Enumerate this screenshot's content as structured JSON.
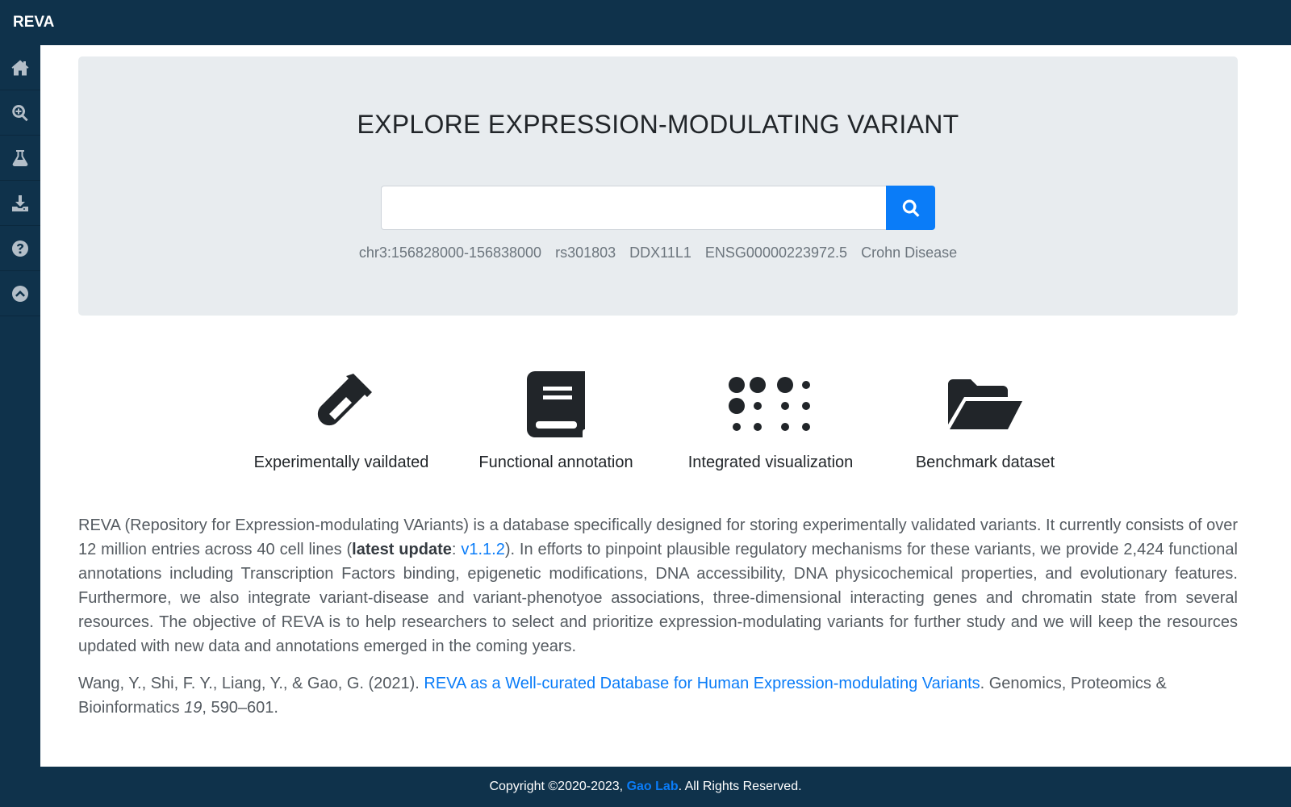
{
  "app": {
    "brand": "REVA"
  },
  "sidebar": {
    "items": [
      {
        "icon": "home-icon"
      },
      {
        "icon": "search-plus-icon"
      },
      {
        "icon": "flask-icon"
      },
      {
        "icon": "download-icon"
      },
      {
        "icon": "question-circle-icon"
      },
      {
        "icon": "chevron-up-circle-icon"
      }
    ]
  },
  "hero": {
    "title": "EXPLORE EXPRESSION-MODULATING VARIANT",
    "search_value": "",
    "examples": [
      "chr3:156828000-156838000",
      "rs301803",
      "DDX11L1",
      "ENSG00000223972.5",
      "Crohn Disease"
    ]
  },
  "features": [
    {
      "icon": "test-tube-icon",
      "label": "Experimentally vaildated"
    },
    {
      "icon": "book-icon",
      "label": "Functional annotation"
    },
    {
      "icon": "braille-icon",
      "label": "Integrated visualization"
    },
    {
      "icon": "folder-open-icon",
      "label": "Benchmark dataset"
    }
  ],
  "description": {
    "part1": "REVA (Repository for Expression-modulating VAriants) is a database specifically designed for storing experimentally validated variants. It currently consists of over 12 million entries across 40 cell lines (",
    "latest_update_label": "latest update",
    "colon": ": ",
    "version_link": "v1.1.2",
    "part2": "). In efforts to pinpoint plausible regulatory mechanisms for these variants, we provide 2,424 functional annotations including Transcription Factors binding, epigenetic modifications, DNA accessibility, DNA physicochemical properties, and evolutionary features. Furthermore, we also integrate variant-disease and variant-phenotyoe associations, three-dimensional interacting genes and chromatin state from several resources. The objective of REVA is to help researchers to select and prioritize expression-modulating variants for further study and we will keep the resources updated with new data and annotations emerged in the coming years."
  },
  "citation": {
    "authors": "Wang, Y., Shi, F. Y., Liang, Y., & Gao, G. (2021). ",
    "title_link": "REVA as a Well-curated Database for Human Expression-modulating Variants",
    "journal": ". Genomics, Proteomics & Bioinformatics ",
    "volume": "19",
    "pages": ", 590–601."
  },
  "footer": {
    "prefix": "Copyright ©2020-2023, ",
    "lab_link": "Gao Lab",
    "suffix": ". All Rights Reserved."
  },
  "colors": {
    "nav_bg": "#0f324b",
    "accent": "#0a7cf8",
    "jumbotron_bg": "#e8ecef"
  }
}
